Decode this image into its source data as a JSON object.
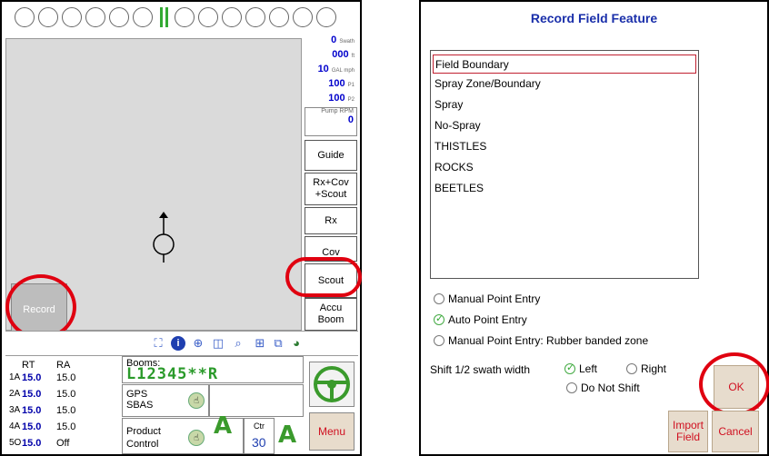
{
  "left": {
    "boom_indicator_circles": 12,
    "readouts": [
      {
        "value": "0",
        "unit": "Swath"
      },
      {
        "value": "000",
        "unit": "ft"
      },
      {
        "value": "10",
        "unit": "GAL mph"
      },
      {
        "value": "100",
        "unit": "P1"
      },
      {
        "value": "100",
        "unit": "P2"
      }
    ],
    "pump_label": "Pump RPM",
    "pump_value": "0",
    "side_buttons": {
      "guide": "Guide",
      "rxcov": "Rx+Cov\n+Scout",
      "rx": "Rx",
      "cov": "Cov",
      "scout": "Scout",
      "acc_boom": "Accu\nBoom"
    },
    "record_label": "Record",
    "rates": {
      "header_rt": "RT",
      "header_ra": "RA",
      "rows": [
        {
          "idx": "1A",
          "rt": "15.0",
          "ra": "15.0"
        },
        {
          "idx": "2A",
          "rt": "15.0",
          "ra": "15.0"
        },
        {
          "idx": "3A",
          "rt": "15.0",
          "ra": "15.0"
        },
        {
          "idx": "4A",
          "rt": "15.0",
          "ra": "15.0"
        },
        {
          "idx": "5O",
          "rt": "15.0",
          "ra": "Off"
        }
      ]
    },
    "booms_label": "Booms:",
    "booms_value": "L12345**R",
    "gps_line1": "GPS",
    "gps_line2": "SBAS",
    "product_line1": "Product",
    "product_line2": "Control",
    "ctr_label": "Ctr",
    "ctr_value": "30",
    "auto_letter": "A",
    "menu_label": "Menu"
  },
  "right": {
    "title": "Record Field Feature",
    "features": [
      "Field Boundary",
      "Spray Zone/Boundary",
      "Spray",
      "No-Spray",
      "THISTLES",
      "ROCKS",
      "BEETLES"
    ],
    "selected_feature": "Field Boundary",
    "entry_options": [
      "Manual Point Entry",
      "Auto Point Entry",
      "Manual Point Entry: Rubber banded zone"
    ],
    "selected_entry": "Auto Point Entry",
    "shift_label": "Shift 1/2 swath width",
    "shift_options": [
      "Left",
      "Right",
      "Do Not Shift"
    ],
    "selected_shift": "Left",
    "ok_label": "OK",
    "import_label": "Import\nField",
    "cancel_label": "Cancel"
  },
  "colors": {
    "highlight": "#e00010",
    "accent_blue": "#1a2faa",
    "auto_green": "#3a9a2c",
    "button_text": "#d01020"
  }
}
